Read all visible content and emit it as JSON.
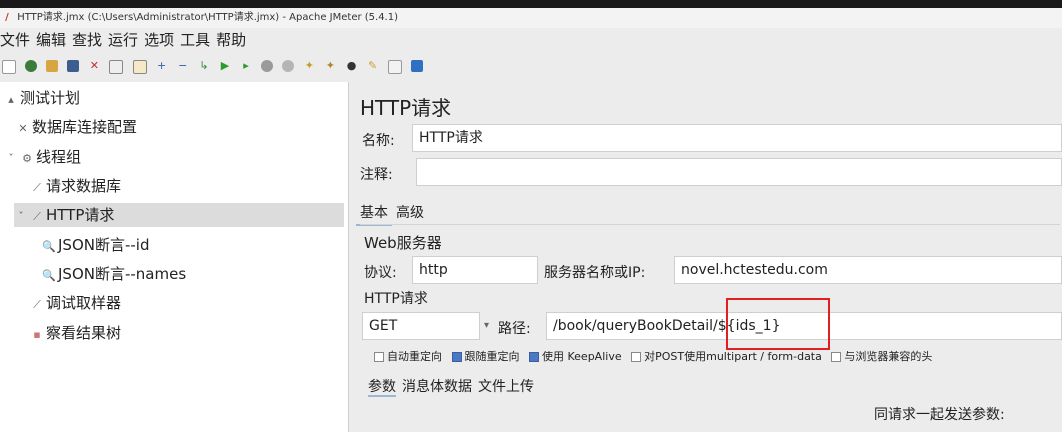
{
  "window": {
    "title": "HTTP请求.jmx (C:\\Users\\Administrator\\HTTP请求.jmx) - Apache JMeter (5.4.1)"
  },
  "menu": [
    "文件",
    "编辑",
    "查找",
    "运行",
    "选项",
    "工具",
    "帮助"
  ],
  "tree": {
    "nodes": [
      {
        "label": "测试计划",
        "icon": "test-plan-icon",
        "glyph": "▴"
      },
      {
        "label": "数据库连接配置",
        "icon": "config-element-icon",
        "glyph": "✕"
      },
      {
        "label": "线程组",
        "icon": "thread-group-icon",
        "glyph": "⚙"
      },
      {
        "label": "请求数据库",
        "icon": "sampler-icon",
        "glyph": "⟋"
      },
      {
        "label": "HTTP请求",
        "icon": "sampler-icon",
        "glyph": "⟋"
      },
      {
        "label": "JSON断言--id",
        "icon": "assertion-icon",
        "glyph": "🔍"
      },
      {
        "label": "JSON断言--names",
        "icon": "assertion-icon",
        "glyph": "🔍"
      },
      {
        "label": "调试取样器",
        "icon": "sampler-icon",
        "glyph": "⟋"
      },
      {
        "label": "察看结果树",
        "icon": "listener-icon",
        "glyph": "▪"
      }
    ]
  },
  "panel": {
    "title": "HTTP请求",
    "name_label": "名称:",
    "name_value": "HTTP请求",
    "comment_label": "注释:",
    "comment_value": "",
    "tabs": [
      "基本",
      "高级"
    ],
    "web_server_group": "Web服务器",
    "protocol_label": "协议:",
    "protocol_value": "http",
    "server_label": "服务器名称或IP:",
    "server_value": "novel.hctestedu.com",
    "http_group": "HTTP请求",
    "method_value": "GET",
    "path_label": "路径:",
    "path_value": "/book/queryBookDetail/${ids_1}",
    "checkboxes": [
      {
        "label": "自动重定向",
        "checked": false
      },
      {
        "label": "跟随重定向",
        "checked": true
      },
      {
        "label": "使用 KeepAlive",
        "checked": true
      },
      {
        "label": "对POST使用multipart / form-data",
        "checked": false
      },
      {
        "label": "与浏览器兼容的头",
        "checked": false
      }
    ],
    "param_tabs": [
      "参数",
      "消息体数据",
      "文件上传"
    ],
    "send_params_label": "同请求一起发送参数:"
  },
  "colors": {
    "highlight_box": "#e02020",
    "tab_underline": "#9bb7d4"
  }
}
